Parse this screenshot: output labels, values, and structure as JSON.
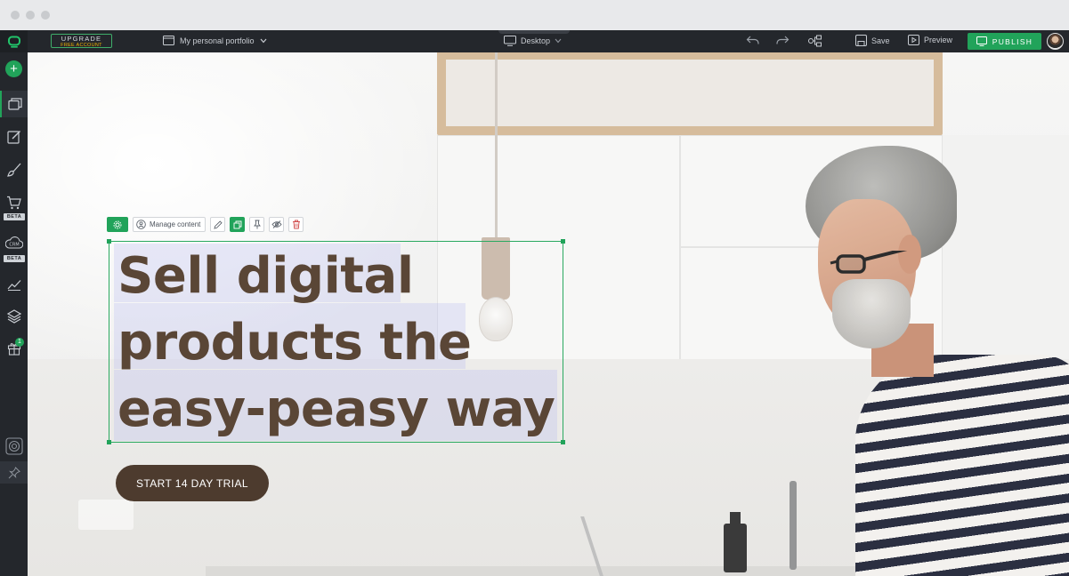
{
  "topbar": {
    "upgrade_line1": "UPGRADE",
    "upgrade_line2": "FREE ACCOUNT",
    "site_name": "My personal portfolio",
    "device": "Desktop",
    "save_label": "Save",
    "preview_label": "Preview",
    "publish_label": "PUBLISH"
  },
  "sidebar": {
    "beta_label_1": "BETA",
    "beta_label_2": "BETA",
    "gift_badge": "1"
  },
  "editor": {
    "manage_content_label": "Manage content"
  },
  "hero": {
    "headline_line1": "Sell digital",
    "headline_line2": "products the",
    "headline_line3": "easy-peasy way",
    "cta_label": "START 14 DAY TRIAL"
  },
  "colors": {
    "toolbar_bg": "#24272c",
    "accent_green": "#21a35a",
    "headline_text": "#5a4636",
    "cta_bg": "#4d3b2e",
    "selection_highlight": "#b2b6f0"
  },
  "icons": [
    "plus-icon",
    "pages-icon",
    "edit-icon",
    "brush-icon",
    "cart-icon",
    "crm-icon",
    "analytics-icon",
    "layers-icon",
    "gift-icon",
    "help-icon",
    "pin-icon",
    "undo-icon",
    "redo-icon",
    "sitemap-icon",
    "save-icon",
    "preview-icon",
    "publish-icon",
    "settings-icon",
    "manage-content-icon",
    "pencil-icon",
    "duplicate-icon",
    "pin-element-icon",
    "hide-icon",
    "delete-icon",
    "desktop-icon",
    "site-icon",
    "chevron-down-icon"
  ]
}
